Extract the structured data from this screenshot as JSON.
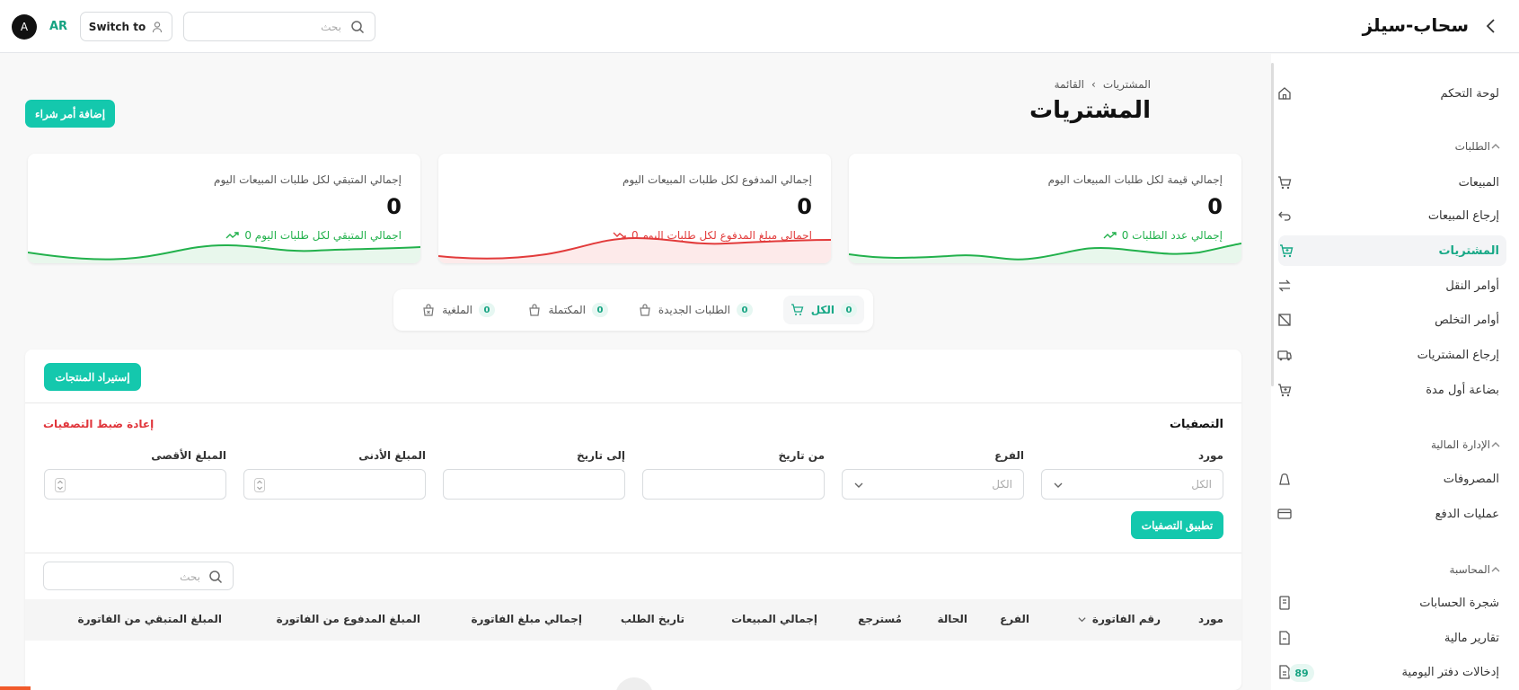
{
  "header": {
    "brand": "سحاب-سيلز",
    "avatar_letter": "A",
    "language": "AR",
    "switch_label": "Switch to",
    "search_placeholder": "بحث"
  },
  "sidebar": {
    "items": [
      {
        "label": "لوحة التحكم",
        "icon": "home-icon"
      },
      {
        "label": "المبيعات",
        "icon": "cart-icon"
      },
      {
        "label": "إرجاع المبيعات",
        "icon": "return-arrow-icon"
      },
      {
        "label": "المشتريات",
        "icon": "cart-plus-icon",
        "active": true
      },
      {
        "label": "أوامر النقل",
        "icon": "transfer-icon"
      },
      {
        "label": "أوامر التخلص",
        "icon": "disposal-icon"
      },
      {
        "label": "إرجاع المشتريات",
        "icon": "truck-return-icon"
      },
      {
        "label": "بضاعة أول مدة",
        "icon": "cart-plus-icon"
      },
      {
        "label": "المصروفات",
        "icon": "wallet-icon"
      },
      {
        "label": "عمليات الدفع",
        "icon": "payment-card-icon"
      },
      {
        "label": "شجرة الحسابات",
        "icon": "ledger-icon"
      },
      {
        "label": "تقارير مالية",
        "icon": "report-icon"
      },
      {
        "label": "إدخالات دفتر اليومية",
        "icon": "journal-icon",
        "badge": "89"
      }
    ],
    "sections": {
      "orders": "الطلبات",
      "finance": "الإدارة المالية",
      "accounting": "المحاسبة"
    }
  },
  "page": {
    "breadcrumb_root": "المشتريات",
    "breadcrumb_current": "القائمة",
    "title": "المشتريات",
    "add_button": "إضافة أمر شراء"
  },
  "cards": [
    {
      "title": "إجمالي قيمة لكل طلبات المبيعات اليوم",
      "value": "0",
      "sub": "إجمالي عدد الطلبات 0",
      "color": "#22b14c"
    },
    {
      "title": "إجمالي المدفوع لكل طلبات المبيعات اليوم",
      "value": "0",
      "sub": "اجمالي مبلغ المدفوع لكل طلبات اليوم 0",
      "color": "#e23b3b"
    },
    {
      "title": "إجمالي المتبقي لكل طلبات المبيعات اليوم",
      "value": "0",
      "sub": "اجمالي المتبقي لكل طلبات اليوم 0",
      "color": "#22b14c"
    }
  ],
  "tabs": [
    {
      "label": "الكل",
      "count": "0"
    },
    {
      "label": "الطلبات الجديدة",
      "count": "0"
    },
    {
      "label": "المكتملة",
      "count": "0"
    },
    {
      "label": "الملغية",
      "count": "0"
    }
  ],
  "panel": {
    "import_button": "إستيراد المنتجات",
    "filters_title": "التصفيات",
    "reset_filters": "إعادة ضبط التصفيات",
    "apply_filters": "تطبيق التصفيات",
    "search_placeholder": "بحث",
    "filters": {
      "supplier": {
        "label": "مورد",
        "placeholder": "الكل"
      },
      "branch": {
        "label": "الفرع",
        "placeholder": "الكل"
      },
      "from_date": {
        "label": "من تاريخ"
      },
      "to_date": {
        "label": "إلى تاريخ"
      },
      "min_amount": {
        "label": "المبلغ الأدنى"
      },
      "max_amount": {
        "label": "المبلغ الأقصى"
      }
    }
  },
  "table": {
    "columns": [
      "مورد",
      "رقم الفاتورة",
      "الفرع",
      "الحالة",
      "مُسترجع",
      "إجمالي المبيعات",
      "تاريخ الطلب",
      "إجمالي مبلغ الفاتورة",
      "المبلغ المدفوع من الفاتورة",
      "المبلغ المتبقي من الفاتورة"
    ]
  },
  "colors": {
    "accent": "#14c8ad",
    "active_text": "#17a886",
    "danger": "#e23b3b"
  }
}
